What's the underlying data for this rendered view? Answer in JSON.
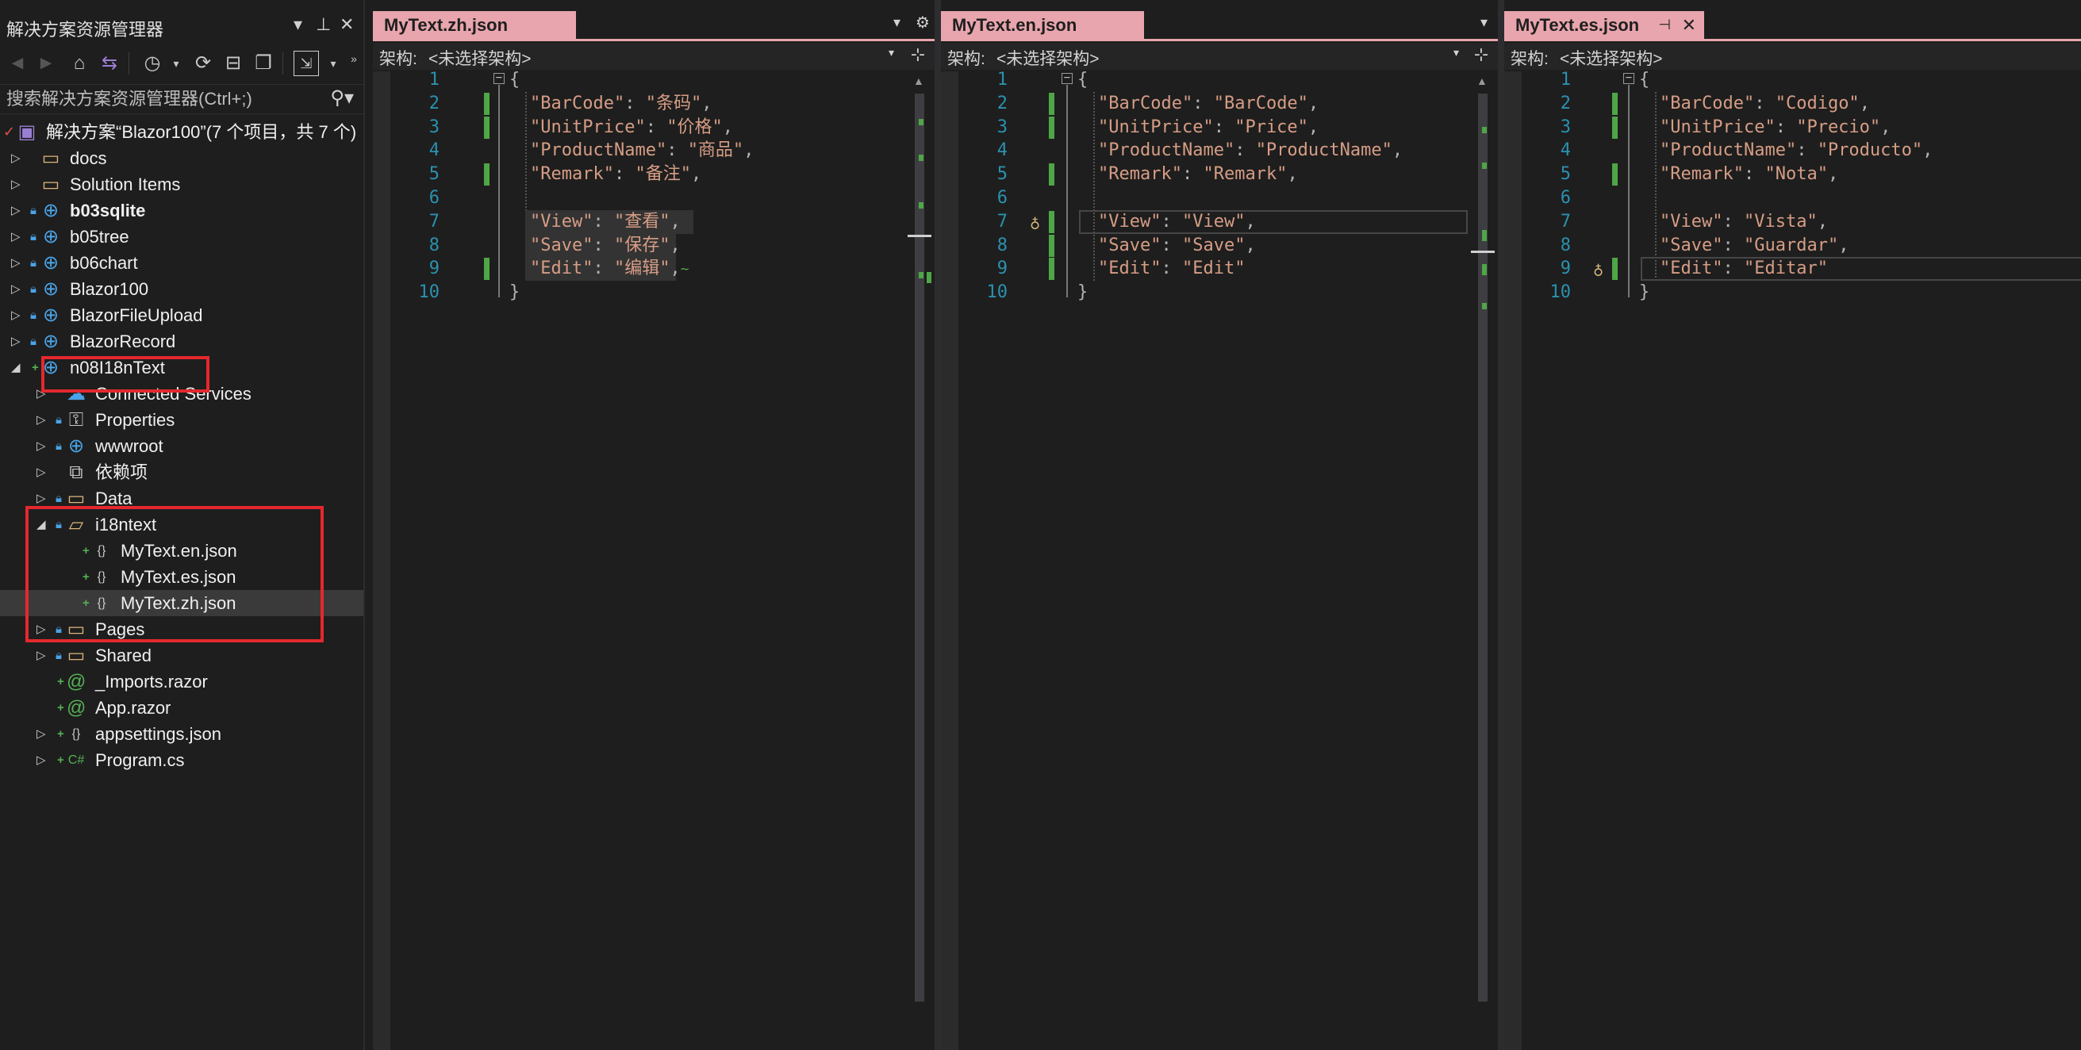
{
  "solution_explorer": {
    "title": "解决方案资源管理器",
    "title_controls": [
      "▾",
      "⊥",
      "✕"
    ],
    "search_placeholder": "搜索解决方案资源管理器(Ctrl+;)",
    "tree": [
      {
        "label": "解决方案“Blazor100”(7 个项目，共 7 个)",
        "level": 0,
        "expander": "",
        "icon": "solution-icon",
        "marker": "check",
        "bold": false
      },
      {
        "label": "docs",
        "level": 1,
        "expander": "collapsed",
        "icon": "folder-icon",
        "marker": "",
        "bold": false
      },
      {
        "label": "Solution Items",
        "level": 1,
        "expander": "collapsed",
        "icon": "folder-icon",
        "marker": "",
        "bold": false
      },
      {
        "label": "b03sqlite",
        "level": 1,
        "expander": "collapsed",
        "icon": "web-project-icon",
        "marker": "lock",
        "bold": true
      },
      {
        "label": "b05tree",
        "level": 1,
        "expander": "collapsed",
        "icon": "web-project-icon",
        "marker": "lock",
        "bold": false
      },
      {
        "label": "b06chart",
        "level": 1,
        "expander": "collapsed",
        "icon": "web-project-icon",
        "marker": "lock",
        "bold": false
      },
      {
        "label": "Blazor100",
        "level": 1,
        "expander": "collapsed",
        "icon": "web-project-icon",
        "marker": "lock",
        "bold": false
      },
      {
        "label": "BlazorFileUpload",
        "level": 1,
        "expander": "collapsed",
        "icon": "web-project-icon",
        "marker": "lock",
        "bold": false
      },
      {
        "label": "BlazorRecord",
        "level": 1,
        "expander": "collapsed",
        "icon": "web-project-icon",
        "marker": "lock",
        "bold": false
      },
      {
        "label": "n08I18nText",
        "level": 1,
        "expander": "expanded",
        "icon": "web-project-icon",
        "marker": "plus",
        "bold": false
      },
      {
        "label": "Connected Services",
        "level": 2,
        "expander": "collapsed",
        "icon": "connected-services-icon",
        "marker": "",
        "bold": false
      },
      {
        "label": "Properties",
        "level": 2,
        "expander": "collapsed",
        "icon": "properties-icon",
        "marker": "lock",
        "bold": false
      },
      {
        "label": "wwwroot",
        "level": 2,
        "expander": "collapsed",
        "icon": "globe-icon",
        "marker": "lock",
        "bold": false
      },
      {
        "label": "依赖项",
        "level": 2,
        "expander": "collapsed",
        "icon": "dependencies-icon",
        "marker": "",
        "bold": false
      },
      {
        "label": "Data",
        "level": 2,
        "expander": "collapsed",
        "icon": "folder-icon",
        "marker": "lock",
        "bold": false
      },
      {
        "label": "i18ntext",
        "level": 2,
        "expander": "expanded",
        "icon": "folder-open-icon",
        "marker": "lock",
        "bold": false
      },
      {
        "label": "MyText.en.json",
        "level": 3,
        "expander": "",
        "icon": "json-file-icon",
        "marker": "plus",
        "bold": false
      },
      {
        "label": "MyText.es.json",
        "level": 3,
        "expander": "",
        "icon": "json-file-icon",
        "marker": "plus",
        "bold": false
      },
      {
        "label": "MyText.zh.json",
        "level": 3,
        "expander": "",
        "icon": "json-file-icon",
        "marker": "plus",
        "bold": false,
        "selected": true
      },
      {
        "label": "Pages",
        "level": 2,
        "expander": "collapsed",
        "icon": "folder-icon",
        "marker": "lock",
        "bold": false
      },
      {
        "label": "Shared",
        "level": 2,
        "expander": "collapsed",
        "icon": "folder-icon",
        "marker": "lock",
        "bold": false
      },
      {
        "label": "_Imports.razor",
        "level": 2,
        "expander": "",
        "icon": "razor-file-icon",
        "marker": "plus",
        "bold": false
      },
      {
        "label": "App.razor",
        "level": 2,
        "expander": "",
        "icon": "razor-file-icon",
        "marker": "plus",
        "bold": false
      },
      {
        "label": "appsettings.json",
        "level": 2,
        "expander": "collapsed",
        "icon": "json-file-icon",
        "marker": "plus",
        "bold": false
      },
      {
        "label": "Program.cs",
        "level": 2,
        "expander": "collapsed",
        "icon": "csharp-file-icon",
        "marker": "plus",
        "bold": false
      }
    ]
  },
  "editors": [
    {
      "tab_label": "MyText.zh.json",
      "schema_label": "架构:",
      "schema_value": "<未选择架构>",
      "lines": [
        {
          "n": "1",
          "key": "",
          "val": "",
          "raw": "{"
        },
        {
          "n": "2",
          "key": "\"BarCode\"",
          "val": "\"条码\""
        },
        {
          "n": "3",
          "key": "\"UnitPrice\"",
          "val": "\"价格\""
        },
        {
          "n": "4",
          "key": "\"ProductName\"",
          "val": "\"商品\""
        },
        {
          "n": "5",
          "key": "\"Remark\"",
          "val": "\"备注\""
        },
        {
          "n": "6",
          "key": "",
          "val": "",
          "raw": ""
        },
        {
          "n": "7",
          "key": "\"View\"",
          "val": "\"查看\""
        },
        {
          "n": "8",
          "key": "\"Save\"",
          "val": "\"保存\""
        },
        {
          "n": "9",
          "key": "\"Edit\"",
          "val": "\"编辑\""
        },
        {
          "n": "10",
          "key": "",
          "val": "",
          "raw": "}"
        }
      ]
    },
    {
      "tab_label": "MyText.en.json",
      "schema_label": "架构:",
      "schema_value": "<未选择架构>",
      "lines": [
        {
          "n": "1",
          "raw": "{"
        },
        {
          "n": "2",
          "key": "\"BarCode\"",
          "val": "\"BarCode\""
        },
        {
          "n": "3",
          "key": "\"UnitPrice\"",
          "val": "\"Price\""
        },
        {
          "n": "4",
          "key": "\"ProductName\"",
          "val": "\"ProductName\""
        },
        {
          "n": "5",
          "key": "\"Remark\"",
          "val": "\"Remark\""
        },
        {
          "n": "6",
          "raw": ""
        },
        {
          "n": "7",
          "key": "\"View\"",
          "val": "\"View\""
        },
        {
          "n": "8",
          "key": "\"Save\"",
          "val": "\"Save\""
        },
        {
          "n": "9",
          "key": "\"Edit\"",
          "val": "\"Edit\""
        },
        {
          "n": "10",
          "raw": "}"
        }
      ]
    },
    {
      "tab_label": "MyText.es.json",
      "schema_label": "架构:",
      "schema_value": "<未选择架构>",
      "lines": [
        {
          "n": "1",
          "raw": "{"
        },
        {
          "n": "2",
          "key": "\"BarCode\"",
          "val": "\"Codigo\""
        },
        {
          "n": "3",
          "key": "\"UnitPrice\"",
          "val": "\"Precio\""
        },
        {
          "n": "4",
          "key": "\"ProductName\"",
          "val": "\"Producto\""
        },
        {
          "n": "5",
          "key": "\"Remark\"",
          "val": "\"Nota\""
        },
        {
          "n": "6",
          "raw": ""
        },
        {
          "n": "7",
          "key": "\"View\"",
          "val": "\"Vista\""
        },
        {
          "n": "8",
          "key": "\"Save\"",
          "val": "\"Guardar\""
        },
        {
          "n": "9",
          "key": "\"Edit\"",
          "val": "\"Editar\""
        },
        {
          "n": "10",
          "raw": "}"
        }
      ]
    }
  ],
  "colors": {
    "tab_accent": "#e8a5ad",
    "change_bar": "#4ea647",
    "string": "#d69d85",
    "line_number": "#2b91af",
    "highlight_box": "#e4282e"
  }
}
